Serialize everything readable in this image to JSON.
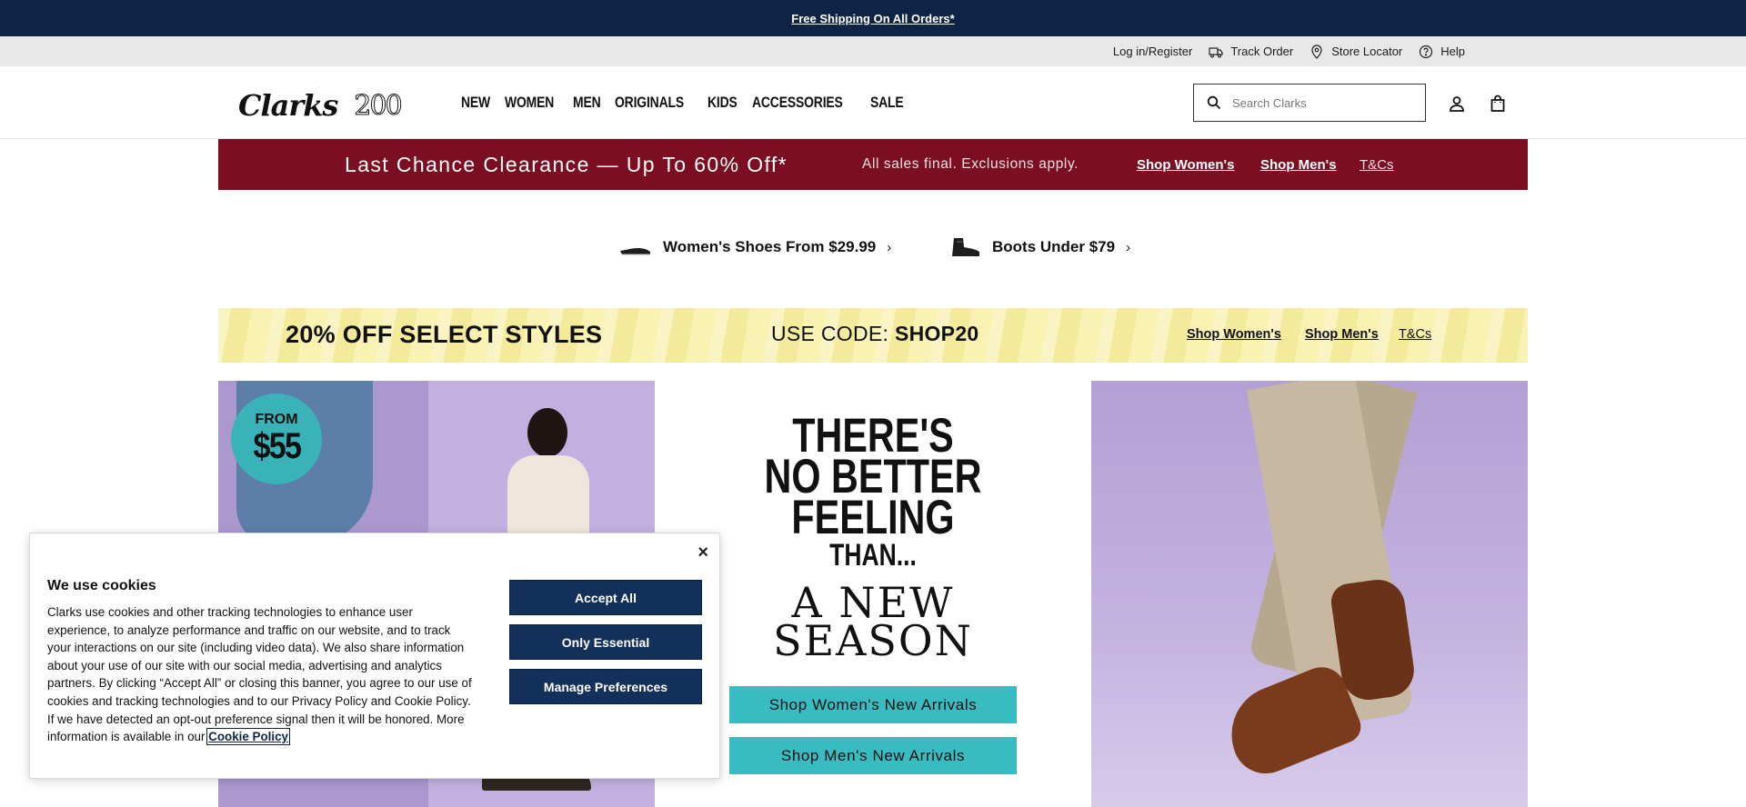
{
  "announcement": {
    "text": "Free Shipping On All Orders*"
  },
  "utility": {
    "login": "Log in/Register",
    "track": "Track Order",
    "store": "Store Locator",
    "help": "Help"
  },
  "header": {
    "brand": "Clarks",
    "anniversary": "200",
    "nav": [
      "NEW",
      "WOMEN",
      "MEN",
      "ORIGINALS",
      "KIDS",
      "ACCESSORIES",
      "SALE"
    ],
    "search_placeholder": "Search Clarks"
  },
  "clearance": {
    "title": "Last Chance Clearance — Up To 60% Off*",
    "subtitle": "All sales final. Exclusions apply.",
    "shop_women": "Shop Women's",
    "shop_men": "Shop Men's",
    "tcs": "T&Cs"
  },
  "promos": {
    "women_shoes": "Women's Shoes From $29.99",
    "boots": "Boots Under $79",
    "chevron": "›"
  },
  "codeband": {
    "offer": "20% OFF SELECT STYLES",
    "code_label": "USE CODE:",
    "code": "SHOP20",
    "shop_women": "Shop Women's",
    "shop_men": "Shop Men's",
    "tcs": "T&Cs"
  },
  "hero": {
    "badge_from": "FROM",
    "badge_price": "$55",
    "line1": "THERE'S",
    "line2": "NO BETTER",
    "line3": "FEELING",
    "line4": "THAN...",
    "line5": "A NEW",
    "line6": "SEASON",
    "cta_women": "Shop Women's New Arrivals",
    "cta_men": "Shop Men's New Arrivals"
  },
  "cookie": {
    "close": "×",
    "title": "We use cookies",
    "body": "Clarks use cookies and other tracking technologies to enhance user experience, to analyze performance and traffic on our website, and to track your interactions on our site (including video data). We also share information about your use of our site with our social media, advertising and analytics partners. By clicking “Accept All” or closing this banner, you agree to our use of cookies and tracking technologies and to our Privacy Policy and Cookie Policy. If we have detected an opt-out preference signal then it will be honored. More information is available in our",
    "policy_link": "Cookie Policy",
    "accept": "Accept All",
    "essential": "Only Essential",
    "manage": "Manage Preferences"
  },
  "colors": {
    "navy": "#0f2444",
    "clearance_red": "#7b0e21",
    "code_yellow": "#f7efa6",
    "teal": "#39bcc1",
    "lavender": "#b6a3d6"
  }
}
